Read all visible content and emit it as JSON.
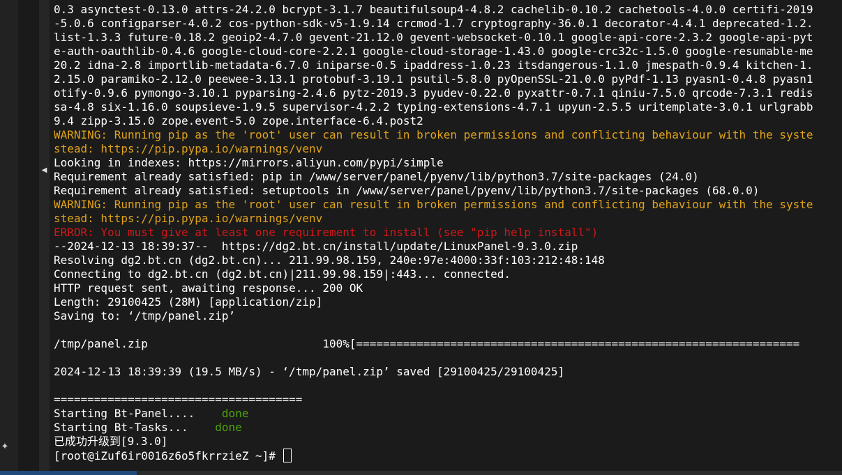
{
  "terminal": {
    "lines": [
      {
        "text": "0.3 asynctest-0.13.0 attrs-24.2.0 bcrypt-3.1.7 beautifulsoup4-4.8.2 cachelib-0.10.2 cachetools-4.0.0 certifi-2019",
        "kind": "normal"
      },
      {
        "text": "-5.0.6 configparser-4.0.2 cos-python-sdk-v5-1.9.14 crcmod-1.7 cryptography-36.0.1 decorator-4.4.1 deprecated-1.2.",
        "kind": "normal"
      },
      {
        "text": "list-1.3.3 future-0.18.2 geoip2-4.7.0 gevent-21.12.0 gevent-websocket-0.10.1 google-api-core-2.3.2 google-api-pyt",
        "kind": "normal"
      },
      {
        "text": "e-auth-oauthlib-0.4.6 google-cloud-core-2.2.1 google-cloud-storage-1.43.0 google-crc32c-1.5.0 google-resumable-me",
        "kind": "normal"
      },
      {
        "text": "20.2 idna-2.8 importlib-metadata-6.7.0 iniparse-0.5 ipaddress-1.0.23 itsdangerous-1.1.0 jmespath-0.9.4 kitchen-1.",
        "kind": "normal"
      },
      {
        "text": "2.15.0 paramiko-2.12.0 peewee-3.13.1 protobuf-3.19.1 psutil-5.8.0 pyOpenSSL-21.0.0 pyPdf-1.13 pyasn1-0.4.8 pyasn1",
        "kind": "normal"
      },
      {
        "text": "otify-0.9.6 pymongo-3.10.1 pyparsing-2.4.6 pytz-2019.3 pyudev-0.22.0 pyxattr-0.7.1 qiniu-7.5.0 qrcode-7.3.1 redis",
        "kind": "normal"
      },
      {
        "text": "sa-4.8 six-1.16.0 soupsieve-1.9.5 supervisor-4.2.2 typing-extensions-4.7.1 upyun-2.5.5 uritemplate-3.0.1 urlgrabb",
        "kind": "normal"
      },
      {
        "text": "9.4 zipp-3.15.0 zope.event-5.0 zope.interface-6.4.post2",
        "kind": "normal"
      },
      {
        "text": "WARNING: Running pip as the 'root' user can result in broken permissions and conflicting behaviour with the syste",
        "kind": "warn"
      },
      {
        "text": "stead: https://pip.pypa.io/warnings/venv",
        "kind": "warn"
      },
      {
        "text": "Looking in indexes: https://mirrors.aliyun.com/pypi/simple",
        "kind": "normal"
      },
      {
        "text": "Requirement already satisfied: pip in /www/server/panel/pyenv/lib/python3.7/site-packages (24.0)",
        "kind": "normal"
      },
      {
        "text": "Requirement already satisfied: setuptools in /www/server/panel/pyenv/lib/python3.7/site-packages (68.0.0)",
        "kind": "normal"
      },
      {
        "text": "WARNING: Running pip as the 'root' user can result in broken permissions and conflicting behaviour with the syste",
        "kind": "warn"
      },
      {
        "text": "stead: https://pip.pypa.io/warnings/venv",
        "kind": "warn"
      },
      {
        "text": "ERROR: You must give at least one requirement to install (see \"pip help install\")",
        "kind": "err"
      },
      {
        "text": "--2024-12-13 18:39:37--  https://dg2.bt.cn/install/update/LinuxPanel-9.3.0.zip",
        "kind": "normal"
      },
      {
        "text": "Resolving dg2.bt.cn (dg2.bt.cn)... 211.99.98.159, 240e:97e:4000:33f:103:212:48:148",
        "kind": "normal"
      },
      {
        "text": "Connecting to dg2.bt.cn (dg2.bt.cn)|211.99.98.159|:443... connected.",
        "kind": "normal"
      },
      {
        "text": "HTTP request sent, awaiting response... 200 OK",
        "kind": "normal"
      },
      {
        "text": "Length: 29100425 (28M) [application/zip]",
        "kind": "normal"
      },
      {
        "text": "Saving to: ‘/tmp/panel.zip’",
        "kind": "normal"
      },
      {
        "text": "",
        "kind": "normal"
      },
      {
        "text": "/tmp/panel.zip                          100%[==================================================================",
        "kind": "normal"
      },
      {
        "text": "",
        "kind": "normal"
      },
      {
        "text": "2024-12-13 18:39:39 (19.5 MB/s) - ‘/tmp/panel.zip’ saved [29100425/29100425]",
        "kind": "normal"
      },
      {
        "text": "",
        "kind": "normal"
      },
      {
        "text": "=====================================",
        "kind": "normal"
      },
      {
        "text": "Starting Bt-Panel....",
        "status": "done",
        "kind": "status"
      },
      {
        "text": "Starting Bt-Tasks...",
        "status": "done",
        "kind": "status"
      },
      {
        "text": "已成功升级到[9.3.0]",
        "kind": "normal"
      }
    ],
    "prompt": "[root@iZuf6ir0016z6o5fkrrzieZ ~]# "
  },
  "colors": {
    "background": "#1b1b1b",
    "text": "#ffffff",
    "warning": "#e0a31a",
    "error": "#d01818",
    "done": "#4fa40e"
  },
  "icons": {
    "collapse": "chevron-left-icon",
    "pin": "pin-icon"
  }
}
